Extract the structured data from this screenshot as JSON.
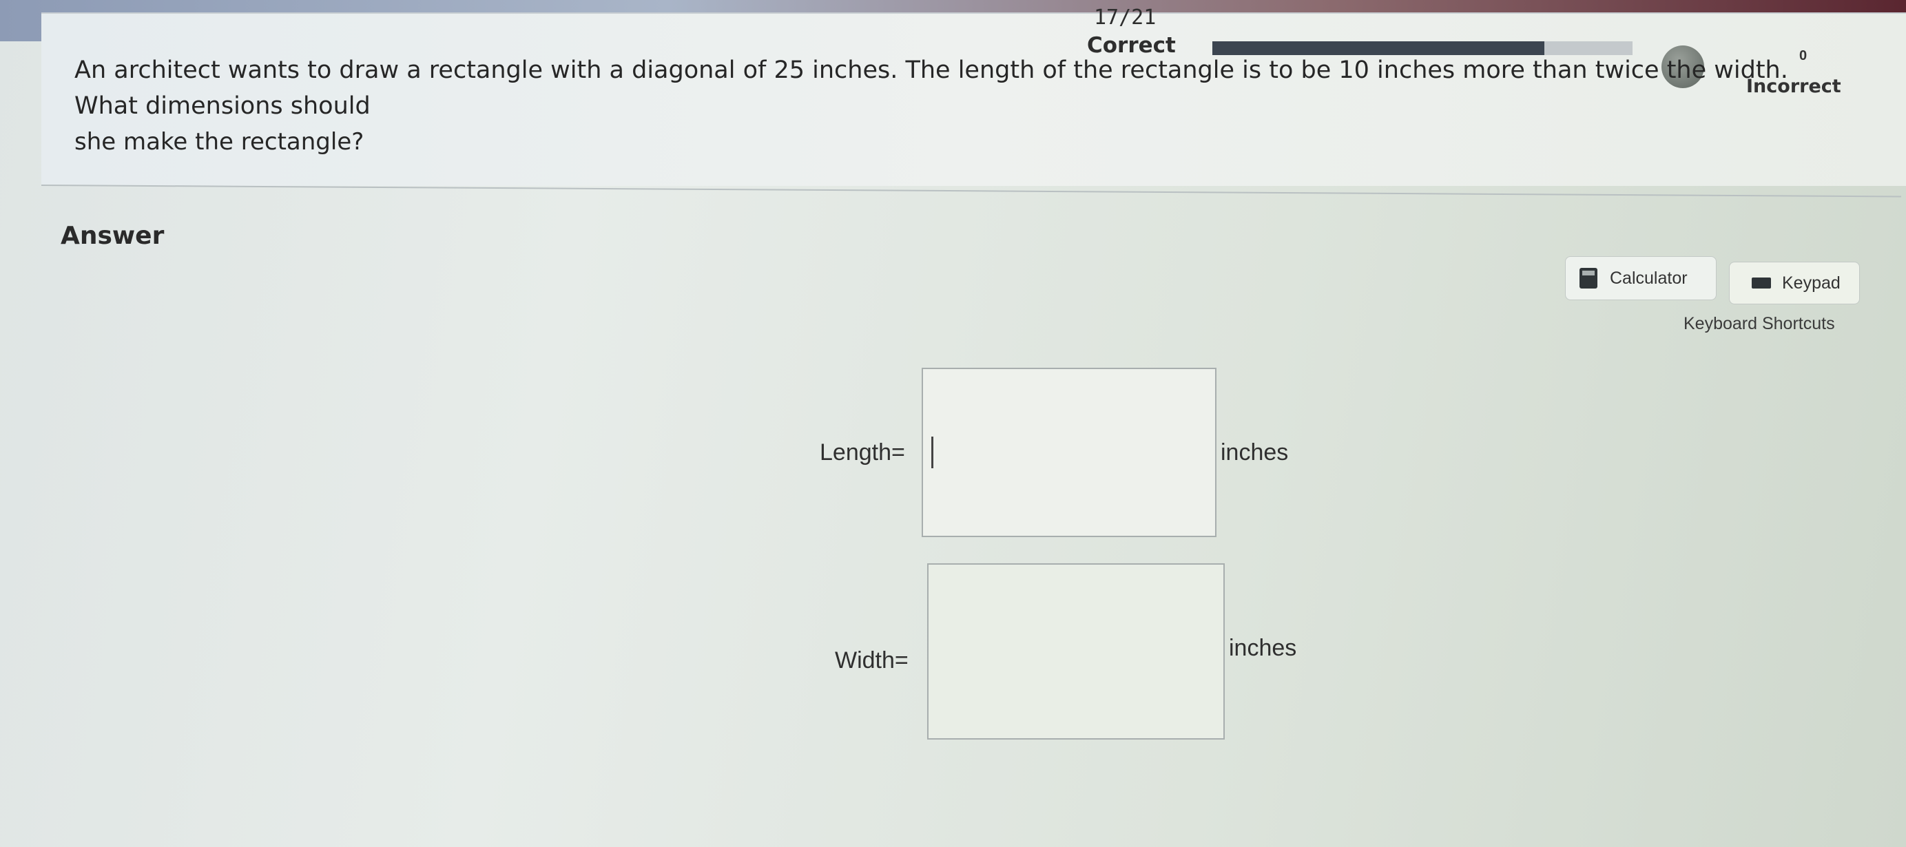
{
  "header": {
    "progress_count": "17/21",
    "correct_label": "Correct",
    "progress_fraction": 0.79,
    "incorrect_count": "0",
    "incorrect_label": "Incorrect"
  },
  "question": {
    "line1": "An architect wants to draw a rectangle with a diagonal of 25 inches. The length of the rectangle is to be 10 inches more than twice the width. What dimensions should",
    "line2": "she make the rectangle?"
  },
  "answer": {
    "label": "Answer",
    "tools": {
      "calculator_label": "Calculator",
      "keypad_label": "Keypad",
      "shortcuts_label": "Keyboard Shortcuts"
    },
    "fields": {
      "length_label": "Length=",
      "length_value": "",
      "length_unit": "inches",
      "width_label": "Width=",
      "width_value": "",
      "width_unit": "inches"
    }
  },
  "icons": {
    "calculator": "calculator-icon",
    "keypad": "keypad-icon",
    "avatar": "incorrect-avatar-icon"
  }
}
